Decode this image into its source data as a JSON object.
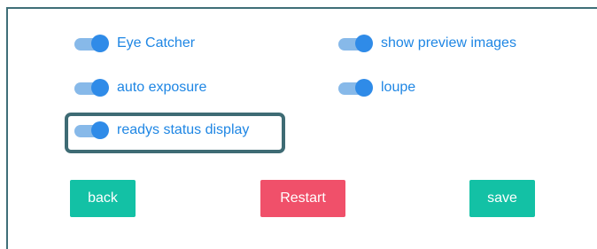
{
  "settings": {
    "eye_catcher": {
      "label": "Eye Catcher",
      "enabled": true
    },
    "show_preview_images": {
      "label": "show preview images",
      "enabled": true
    },
    "auto_exposure": {
      "label": "auto exposure",
      "enabled": true
    },
    "loupe": {
      "label": "loupe",
      "enabled": true
    },
    "readys_status_display": {
      "label": "readys status display",
      "enabled": true
    }
  },
  "buttons": {
    "back": {
      "label": "back",
      "color": "#13c1a5"
    },
    "restart": {
      "label": "Restart",
      "color": "#f0506a"
    },
    "save": {
      "label": "save",
      "color": "#13c1a5"
    }
  },
  "colors": {
    "toggle_track": "#87b9e9",
    "toggle_knob": "#2f8be8",
    "label_text": "#1e86e4",
    "highlight_border": "#3e6b74"
  }
}
